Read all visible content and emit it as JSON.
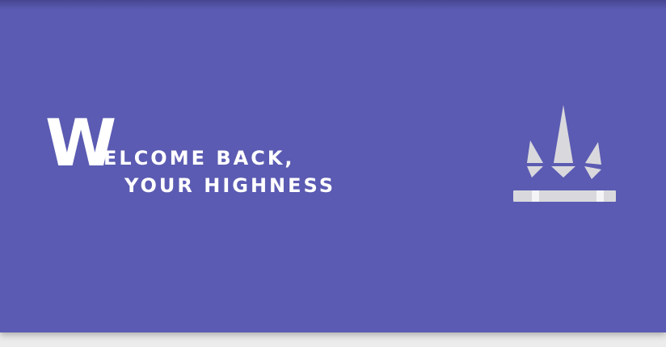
{
  "greeting": {
    "initial": "W",
    "line1": "ELCOME BACK,",
    "line2": "YOUR HIGHNESS"
  },
  "crown": {
    "icon": "crown-icon"
  },
  "colors": {
    "background": "#5b5bb3",
    "text": "#ffffff",
    "icon": "#d9d9dd"
  }
}
